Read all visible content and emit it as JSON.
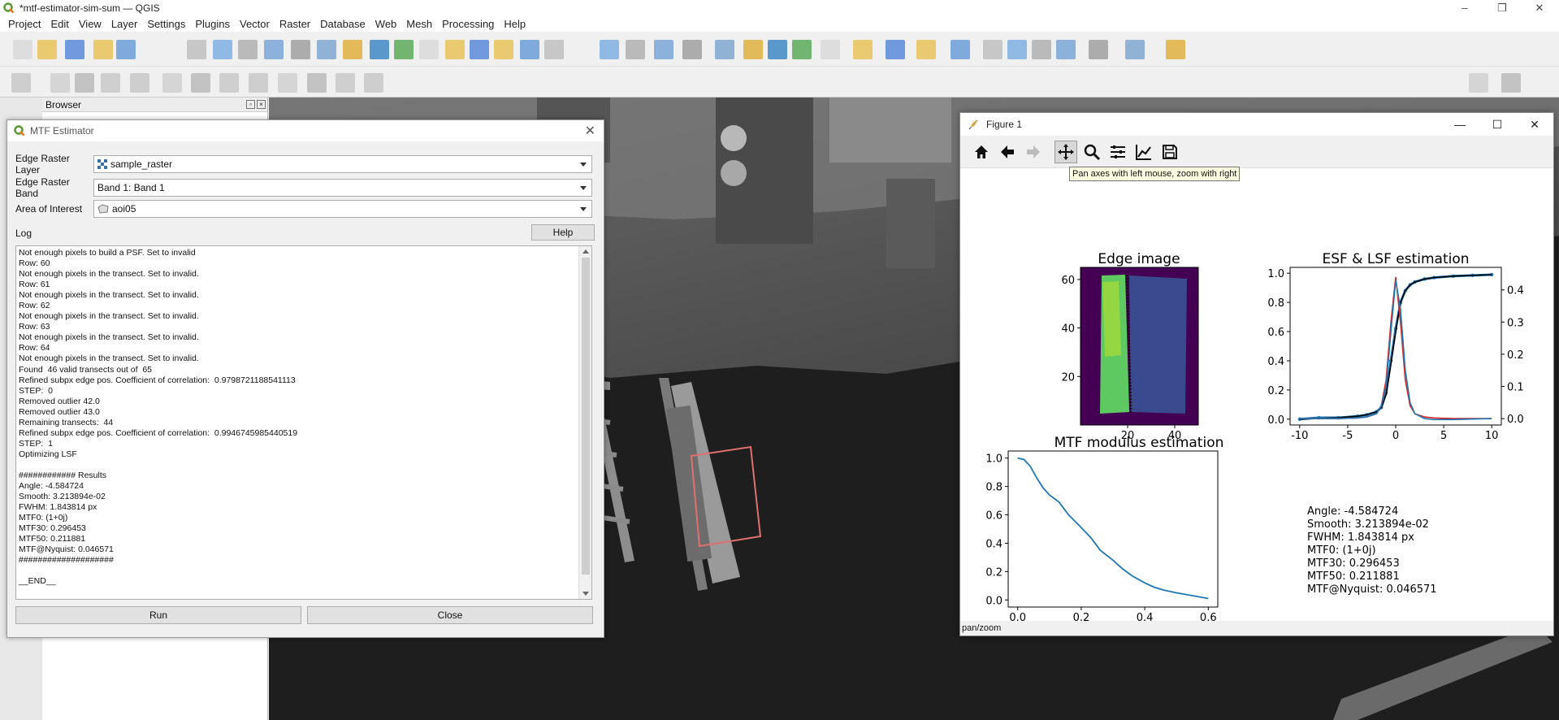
{
  "app": {
    "window_title": "*mtf-estimator-sim-sum — QGIS",
    "menu": [
      "Project",
      "Edit",
      "View",
      "Layer",
      "Settings",
      "Plugins",
      "Vector",
      "Raster",
      "Database",
      "Web",
      "Mesh",
      "Processing",
      "Help"
    ],
    "browser_panel_title": "Browser"
  },
  "dialog": {
    "title": "MTF Estimator",
    "edge_layer_label": "Edge Raster Layer",
    "edge_layer_value": "sample_raster",
    "edge_band_label": "Edge Raster Band",
    "edge_band_value": "Band 1: Band 1",
    "aoi_label": "Area of Interest",
    "aoi_value": "aoi05",
    "log_label": "Log",
    "help_label": "Help",
    "run_label": "Run",
    "close_label": "Close",
    "log_lines": [
      "Not enough pixels to build a PSF. Set to invalid",
      "Row: 60",
      "Not enough pixels in the transect. Set to invalid.",
      "Row: 61",
      "Not enough pixels in the transect. Set to invalid.",
      "Row: 62",
      "Not enough pixels in the transect. Set to invalid.",
      "Row: 63",
      "Not enough pixels in the transect. Set to invalid.",
      "Row: 64",
      "Not enough pixels in the transect. Set to invalid.",
      "Found  46 valid transects out of  65",
      "Refined subpx edge pos. Coefficient of correlation:  0.9798721188541113",
      "STEP:  0",
      "Removed outlier 42.0",
      "Removed outlier 43.0",
      "Remaining transects:  44",
      "Refined subpx edge pos. Coefficient of correlation:  0.9946745985440519",
      "STEP:  1",
      "Optimizing LSF",
      "",
      "############ Results",
      "Angle: -4.584724",
      "Smooth: 3.213894e-02",
      "FWHM: 1.843814 px",
      "MTF0: (1+0j)",
      "MTF30: 0.296453",
      "MTF50: 0.211881",
      "MTF@Nyquist: 0.046571",
      "####################",
      "",
      "__END__"
    ]
  },
  "figure": {
    "window_title": "Figure 1",
    "tooltip": "Pan axes with left mouse, zoom with right",
    "status": "pan/zoom",
    "toolbar_icons": [
      "home-icon",
      "back-icon",
      "forward-icon",
      "pan-icon",
      "zoom-icon",
      "configure-subplots-icon",
      "edit-axis-icon",
      "save-icon"
    ],
    "results_text": [
      "Angle: -4.584724",
      "Smooth: 3.213894e-02",
      "FWHM: 1.843814 px",
      "MTF0: (1+0j)",
      "MTF30: 0.296453",
      "MTF50: 0.211881",
      "MTF@Nyquist: 0.046571"
    ]
  },
  "chart_data": [
    {
      "type": "heatmap",
      "title": "Edge image",
      "xticks": [
        20,
        40
      ],
      "yticks": [
        20,
        40,
        60
      ],
      "xlim": [
        0,
        50
      ],
      "ylim": [
        0,
        65
      ]
    },
    {
      "type": "line",
      "title": "ESF & LSF estimation",
      "xticks": [
        -10,
        -5,
        0,
        5,
        10
      ],
      "yticks_left": [
        0.0,
        0.2,
        0.4,
        0.6,
        0.8,
        1.0
      ],
      "yticks_right": [
        0.0,
        0.1,
        0.2,
        0.3,
        0.4
      ],
      "xlim": [
        -11,
        11
      ],
      "ylim_left": [
        -0.04,
        1.04
      ],
      "ylim_right": [
        -0.02,
        0.47
      ],
      "series": [
        {
          "color": "#1f77b4",
          "x": [
            -10,
            -8,
            -6,
            -4,
            -3,
            -2,
            -1.5,
            -1,
            -0.5,
            0,
            0.5,
            1,
            1.5,
            2,
            3,
            4,
            6,
            8,
            10
          ],
          "values": [
            0.0,
            0.01,
            0.01,
            0.02,
            0.03,
            0.05,
            0.08,
            0.18,
            0.4,
            0.62,
            0.8,
            0.88,
            0.92,
            0.94,
            0.96,
            0.97,
            0.98,
            0.985,
            0.99
          ]
        },
        {
          "color": "#000000",
          "x": [
            -10,
            -6,
            -4,
            -3,
            -2,
            -1.5,
            -1,
            -0.5,
            0,
            0.5,
            1,
            1.5,
            2,
            3,
            4,
            6,
            10
          ],
          "values": [
            0.0,
            0.01,
            0.02,
            0.03,
            0.05,
            0.08,
            0.17,
            0.38,
            0.6,
            0.8,
            0.88,
            0.92,
            0.94,
            0.96,
            0.97,
            0.98,
            0.99
          ]
        },
        {
          "color": "#d62728",
          "x": [
            -10,
            -6,
            -4,
            -3,
            -2,
            -1.5,
            -1,
            -0.5,
            0,
            0.5,
            1,
            1.5,
            2,
            3,
            4,
            6,
            10
          ],
          "values_right": [
            0.0,
            0.0,
            0.002,
            0.005,
            0.015,
            0.04,
            0.12,
            0.3,
            0.44,
            0.3,
            0.12,
            0.04,
            0.015,
            0.005,
            0.002,
            0.0,
            0.0
          ]
        },
        {
          "color": "#1f77b4",
          "x": [
            -10,
            -6,
            -4,
            -3,
            -2,
            -1.5,
            -1,
            -0.5,
            0,
            0.5,
            1,
            1.5,
            2,
            3,
            4,
            6,
            10
          ],
          "values_right": [
            0.0,
            0.0,
            0.002,
            0.005,
            0.015,
            0.04,
            0.1,
            0.27,
            0.43,
            0.34,
            0.15,
            0.05,
            0.015,
            0.0,
            -0.003,
            -0.003,
            0.0
          ]
        }
      ]
    },
    {
      "type": "line",
      "title": "MTF modulus estimation",
      "xticks": [
        0.0,
        0.2,
        0.4,
        0.6
      ],
      "yticks": [
        0.0,
        0.2,
        0.4,
        0.6,
        0.8,
        1.0
      ],
      "xlim": [
        -0.03,
        0.63
      ],
      "ylim": [
        -0.05,
        1.05
      ],
      "series": [
        {
          "color": "#1f77b4",
          "x": [
            0.0,
            0.02,
            0.04,
            0.06,
            0.08,
            0.1,
            0.13,
            0.16,
            0.2,
            0.23,
            0.26,
            0.3,
            0.33,
            0.36,
            0.4,
            0.43,
            0.46,
            0.5,
            0.55,
            0.6
          ],
          "values": [
            1.0,
            0.99,
            0.94,
            0.86,
            0.79,
            0.74,
            0.69,
            0.6,
            0.51,
            0.44,
            0.35,
            0.28,
            0.22,
            0.17,
            0.12,
            0.09,
            0.07,
            0.05,
            0.03,
            0.01
          ]
        }
      ]
    }
  ]
}
